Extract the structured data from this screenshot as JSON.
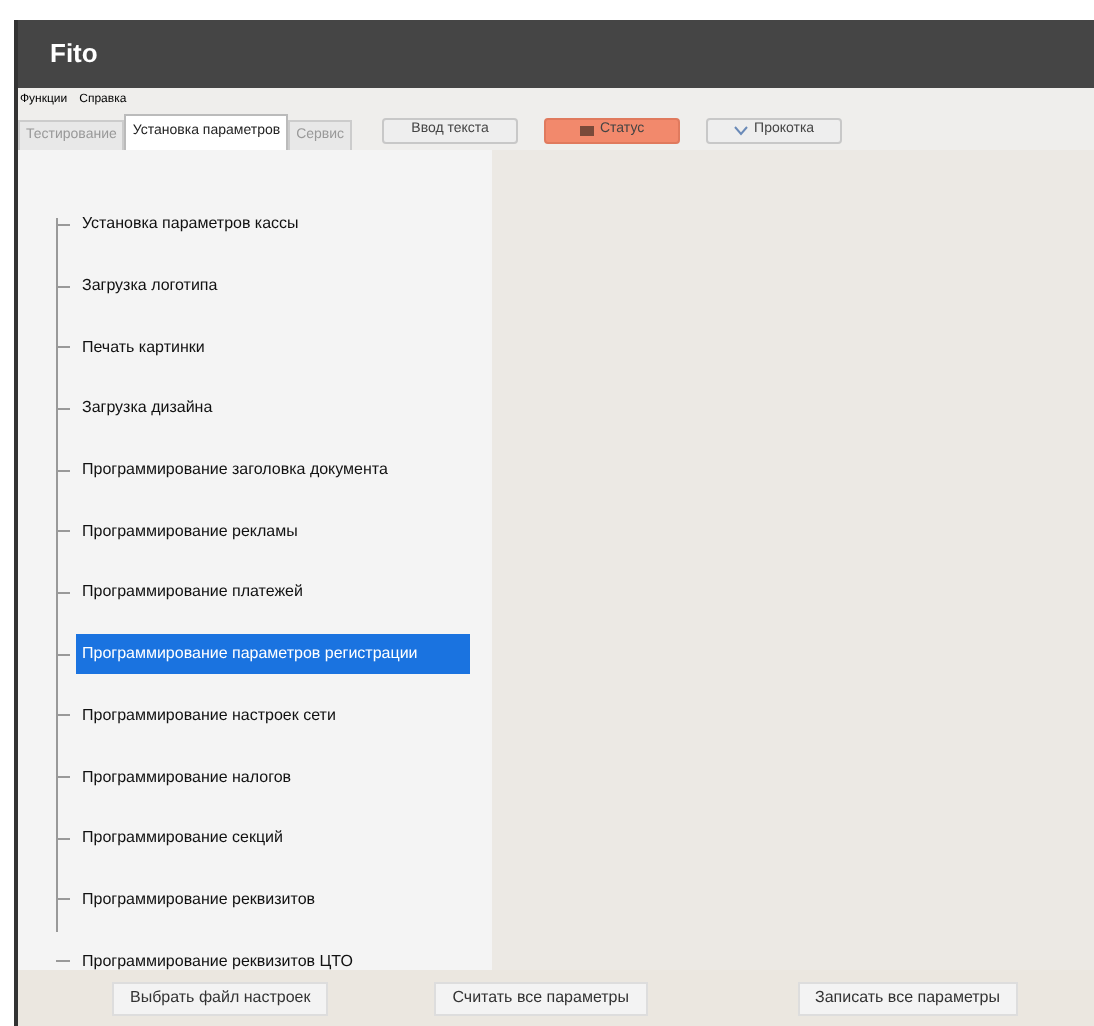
{
  "window": {
    "title": "Fito"
  },
  "menu": [
    "Функции",
    "Справка"
  ],
  "tabs": [
    {
      "label": "Тестирование",
      "selected": false
    },
    {
      "label": "Установка параметров",
      "selected": true
    },
    {
      "label": "Сервис",
      "selected": false
    }
  ],
  "toolbar": [
    {
      "label": "Ввод текста",
      "kind": "plain"
    },
    {
      "label": "Статус",
      "kind": "status"
    },
    {
      "label": "Прокотка",
      "kind": "feed"
    }
  ],
  "tree": [
    {
      "label": "Установка параметров кассы",
      "selected": false
    },
    {
      "label": "Загрузка логотипа",
      "selected": false
    },
    {
      "label": "Печать картинки",
      "selected": false
    },
    {
      "label": "Загрузка дизайна",
      "selected": false
    },
    {
      "label": "Программирование заголовка документа",
      "selected": false
    },
    {
      "label": "Программирование рекламы",
      "selected": false
    },
    {
      "label": "Программирование платежей",
      "selected": false
    },
    {
      "label": "Программирование параметров регистрации",
      "selected": true
    },
    {
      "label": "Программирование настроек сети",
      "selected": false
    },
    {
      "label": "Программирование налогов",
      "selected": false
    },
    {
      "label": "Программирование секций",
      "selected": false
    },
    {
      "label": "Программирование реквизитов",
      "selected": false
    },
    {
      "label": "Программирование реквизитов ЦТО",
      "selected": false
    }
  ],
  "buttons": [
    "Выбрать файл настроек",
    "Считать все параметры",
    "Записать все параметры"
  ]
}
